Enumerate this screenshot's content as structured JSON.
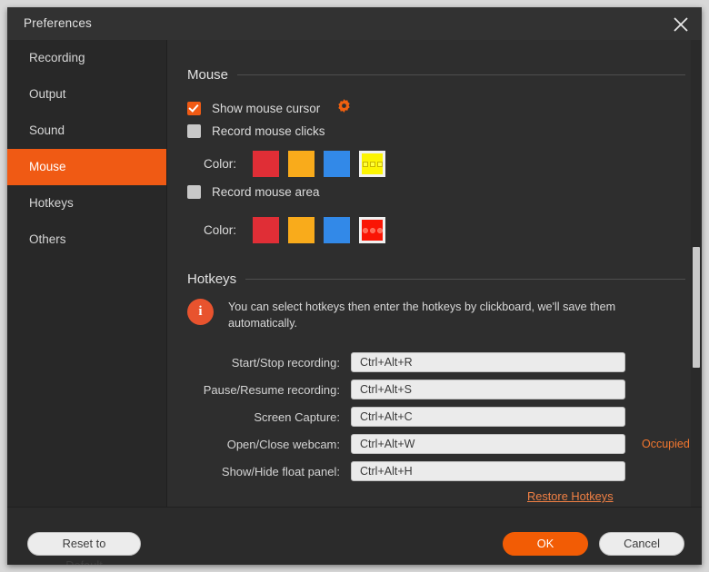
{
  "window": {
    "title": "Preferences",
    "close_icon": "close-icon"
  },
  "sidebar": {
    "items": [
      {
        "label": "Recording",
        "active": false
      },
      {
        "label": "Output",
        "active": false
      },
      {
        "label": "Sound",
        "active": false
      },
      {
        "label": "Mouse",
        "active": true
      },
      {
        "label": "Hotkeys",
        "active": false
      },
      {
        "label": "Others",
        "active": false
      }
    ]
  },
  "mouse_section": {
    "title": "Mouse",
    "show_cursor": {
      "label": "Show mouse cursor",
      "checked": true,
      "settings_icon": "gear-icon"
    },
    "record_clicks": {
      "label": "Record mouse clicks",
      "checked": false
    },
    "clicks_color": {
      "label": "Color:",
      "swatches": [
        "#e02e36",
        "#f9ab1b",
        "#3289e8",
        "#fcf403"
      ],
      "selected_index": 3
    },
    "record_area": {
      "label": "Record mouse area",
      "checked": false
    },
    "area_color": {
      "label": "Color:",
      "swatches": [
        "#e02e36",
        "#f9ab1b",
        "#3289e8",
        "#fa1505"
      ],
      "selected_index": 3
    }
  },
  "hotkeys_section": {
    "title": "Hotkeys",
    "info_icon": "info-icon",
    "info_text": "You can select hotkeys then enter the hotkeys by clickboard, we'll save them automatically.",
    "rows": [
      {
        "label": "Start/Stop recording:",
        "value": "Ctrl+Alt+R",
        "note": ""
      },
      {
        "label": "Pause/Resume recording:",
        "value": "Ctrl+Alt+S",
        "note": ""
      },
      {
        "label": "Screen Capture:",
        "value": "Ctrl+Alt+C",
        "note": ""
      },
      {
        "label": "Open/Close webcam:",
        "value": "Ctrl+Alt+W",
        "note": "Occupied"
      },
      {
        "label": "Show/Hide float panel:",
        "value": "Ctrl+Alt+H",
        "note": ""
      }
    ],
    "restore_link": "Restore Hotkeys"
  },
  "footer": {
    "reset_label": "Reset to Default",
    "ok_label": "OK",
    "cancel_label": "Cancel"
  },
  "colors": {
    "accent": "#f05a14",
    "warning": "#f2772f",
    "link": "#f18044",
    "window_bg": "#2b2b2b",
    "content_bg": "#2e2e2e",
    "sidebar_bg": "#282828"
  }
}
